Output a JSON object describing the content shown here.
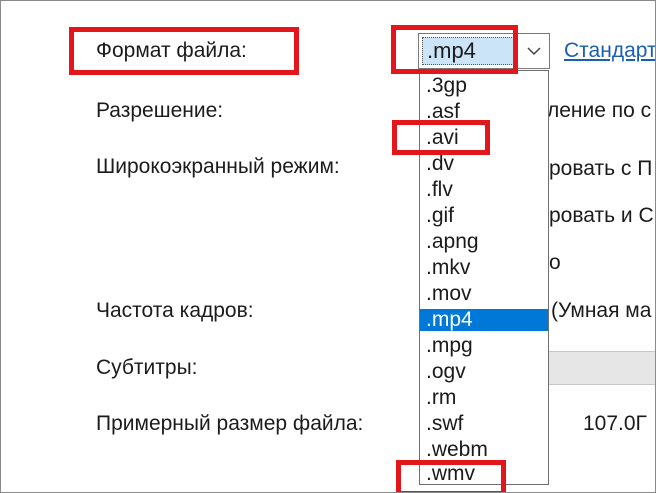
{
  "labels": {
    "file_format": "Формат файла:",
    "resolution": "Разрешение:",
    "widescreen": "Широкоэкранный режим:",
    "framerate": "Частота кадров:",
    "subtitles": "Субтитры:",
    "est_size": "Примерный размер файла:"
  },
  "format_select": {
    "value": ".mp4"
  },
  "standard_link": "Стандарт",
  "partial_values": {
    "resolution": "ление по с",
    "widescreen_1": "ровать с П",
    "widescreen_2": "ровать и С",
    "widescreen_3": "о",
    "framerate": "(Умная ма",
    "est_size": "107.0Г"
  },
  "format_options": [
    ".3gp",
    ".asf",
    ".avi",
    ".dv",
    ".flv",
    ".gif",
    ".apng",
    ".mkv",
    ".mov",
    ".mp4",
    ".mpg",
    ".ogv",
    ".rm",
    ".swf",
    ".webm",
    ".wmv"
  ],
  "selected_option": ".mp4",
  "highlight_color": "#e3161b",
  "selection_color": "#0078d7"
}
